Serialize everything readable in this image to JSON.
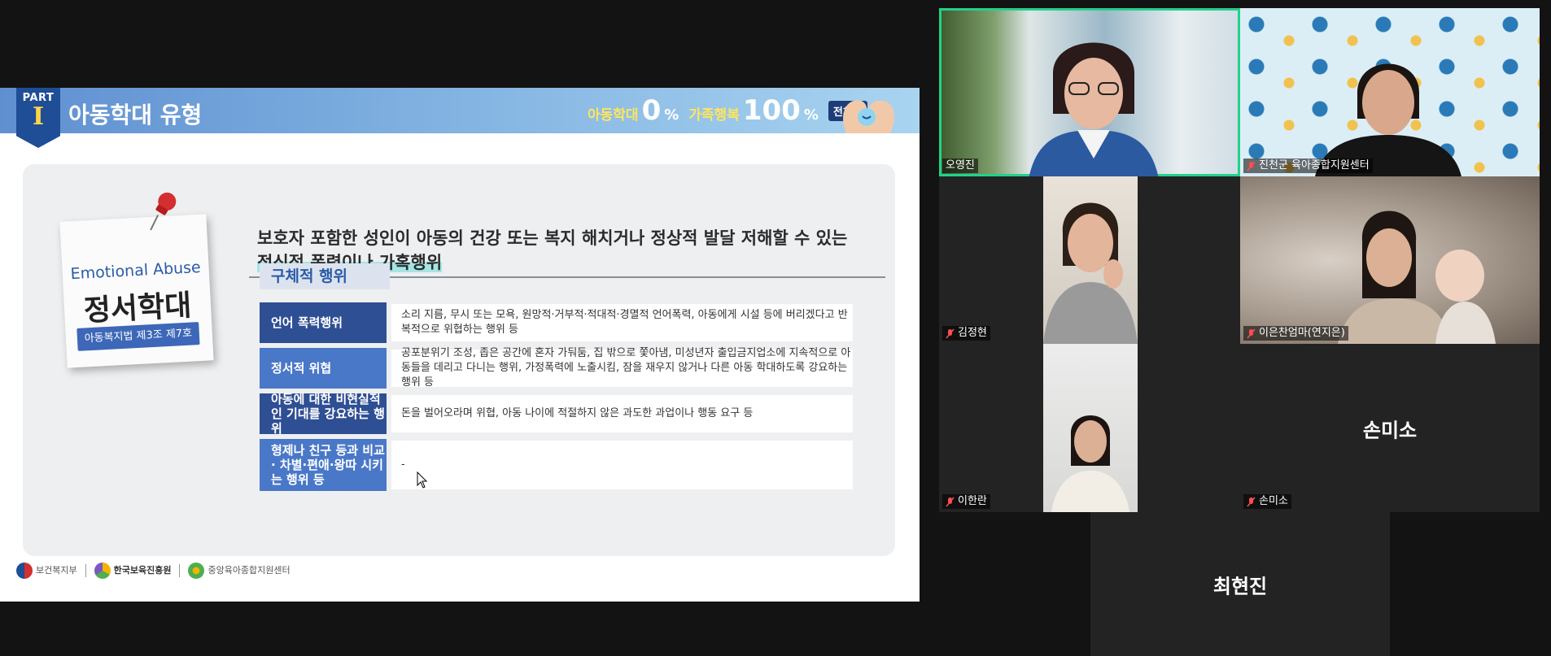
{
  "slide": {
    "part_word": "PART",
    "part_num": "I",
    "title": "아동학대 유형",
    "slogan": {
      "text1": "아동학대",
      "num1": "0",
      "pct1": "%",
      "text2": "가족행복",
      "num2": "100",
      "pct2": "%",
      "badge": "전체편"
    },
    "note": {
      "english": "Emotional Abuse",
      "korean": "정서학대",
      "law": "아동복지법 제3조 제7호"
    },
    "definition_line1": "보호자 포함한 성인이 아동의 건강 또는 복지 해치거나 정상적 발달 저해할 수 있는",
    "definition_highlight": "정신적 폭력이나 가혹행위",
    "concrete_label": "구체적 행위",
    "rows": [
      {
        "head": "언어 폭력행위",
        "body": "소리 지름, 무시 또는 모욕, 원망적·거부적·적대적·경멸적 언어폭력, 아동에게 시설 등에 버리겠다고 반복적으로 위협하는 행위 등"
      },
      {
        "head": "정서적 위협",
        "body": "공포분위기 조성, 좁은 공간에 혼자 가둬둠, 집 밖으로 쫓아냄, 미성년자 출입금지업소에 지속적으로 아동들을 데리고 다니는 행위, 가정폭력에 노출시킴, 잠을 재우지 않거나 다른 아동 학대하도록 강요하는 행위 등"
      },
      {
        "head": "아동에 대한 비현실적인 기대를 강요하는 행위",
        "body": "돈을 벌어오라며 위협, 아동 나이에 적절하지 않은 과도한 과업이나 행동 요구 등"
      },
      {
        "head": "형제나 친구 등과 비교· 차별·편애·왕따 시키는 행위 등",
        "body": "-"
      }
    ],
    "footer": {
      "org1": "보건복지부",
      "org2": "한국보육진흥원",
      "org3": "중앙육아종합지원센터"
    }
  },
  "participants": [
    {
      "name": "오영진",
      "active": true,
      "muted": false
    },
    {
      "name": "진천군 육아종합지원센터",
      "active": false,
      "muted": true
    },
    {
      "name": "김정현",
      "active": false,
      "muted": true
    },
    {
      "name": "이은찬엄마(연지은)",
      "active": false,
      "muted": true
    },
    {
      "name": "이한란",
      "active": false,
      "muted": true
    },
    {
      "name": "손미소",
      "active": false,
      "muted": true,
      "video_off": true
    },
    {
      "name": "최현진",
      "active": false,
      "muted": false,
      "video_off": true
    }
  ],
  "colors": {
    "active_border": "#23d18b",
    "banner_blue": "#5f8fd0",
    "row_blue_dark": "#2f4f94",
    "row_blue_light": "#4a78c8"
  }
}
